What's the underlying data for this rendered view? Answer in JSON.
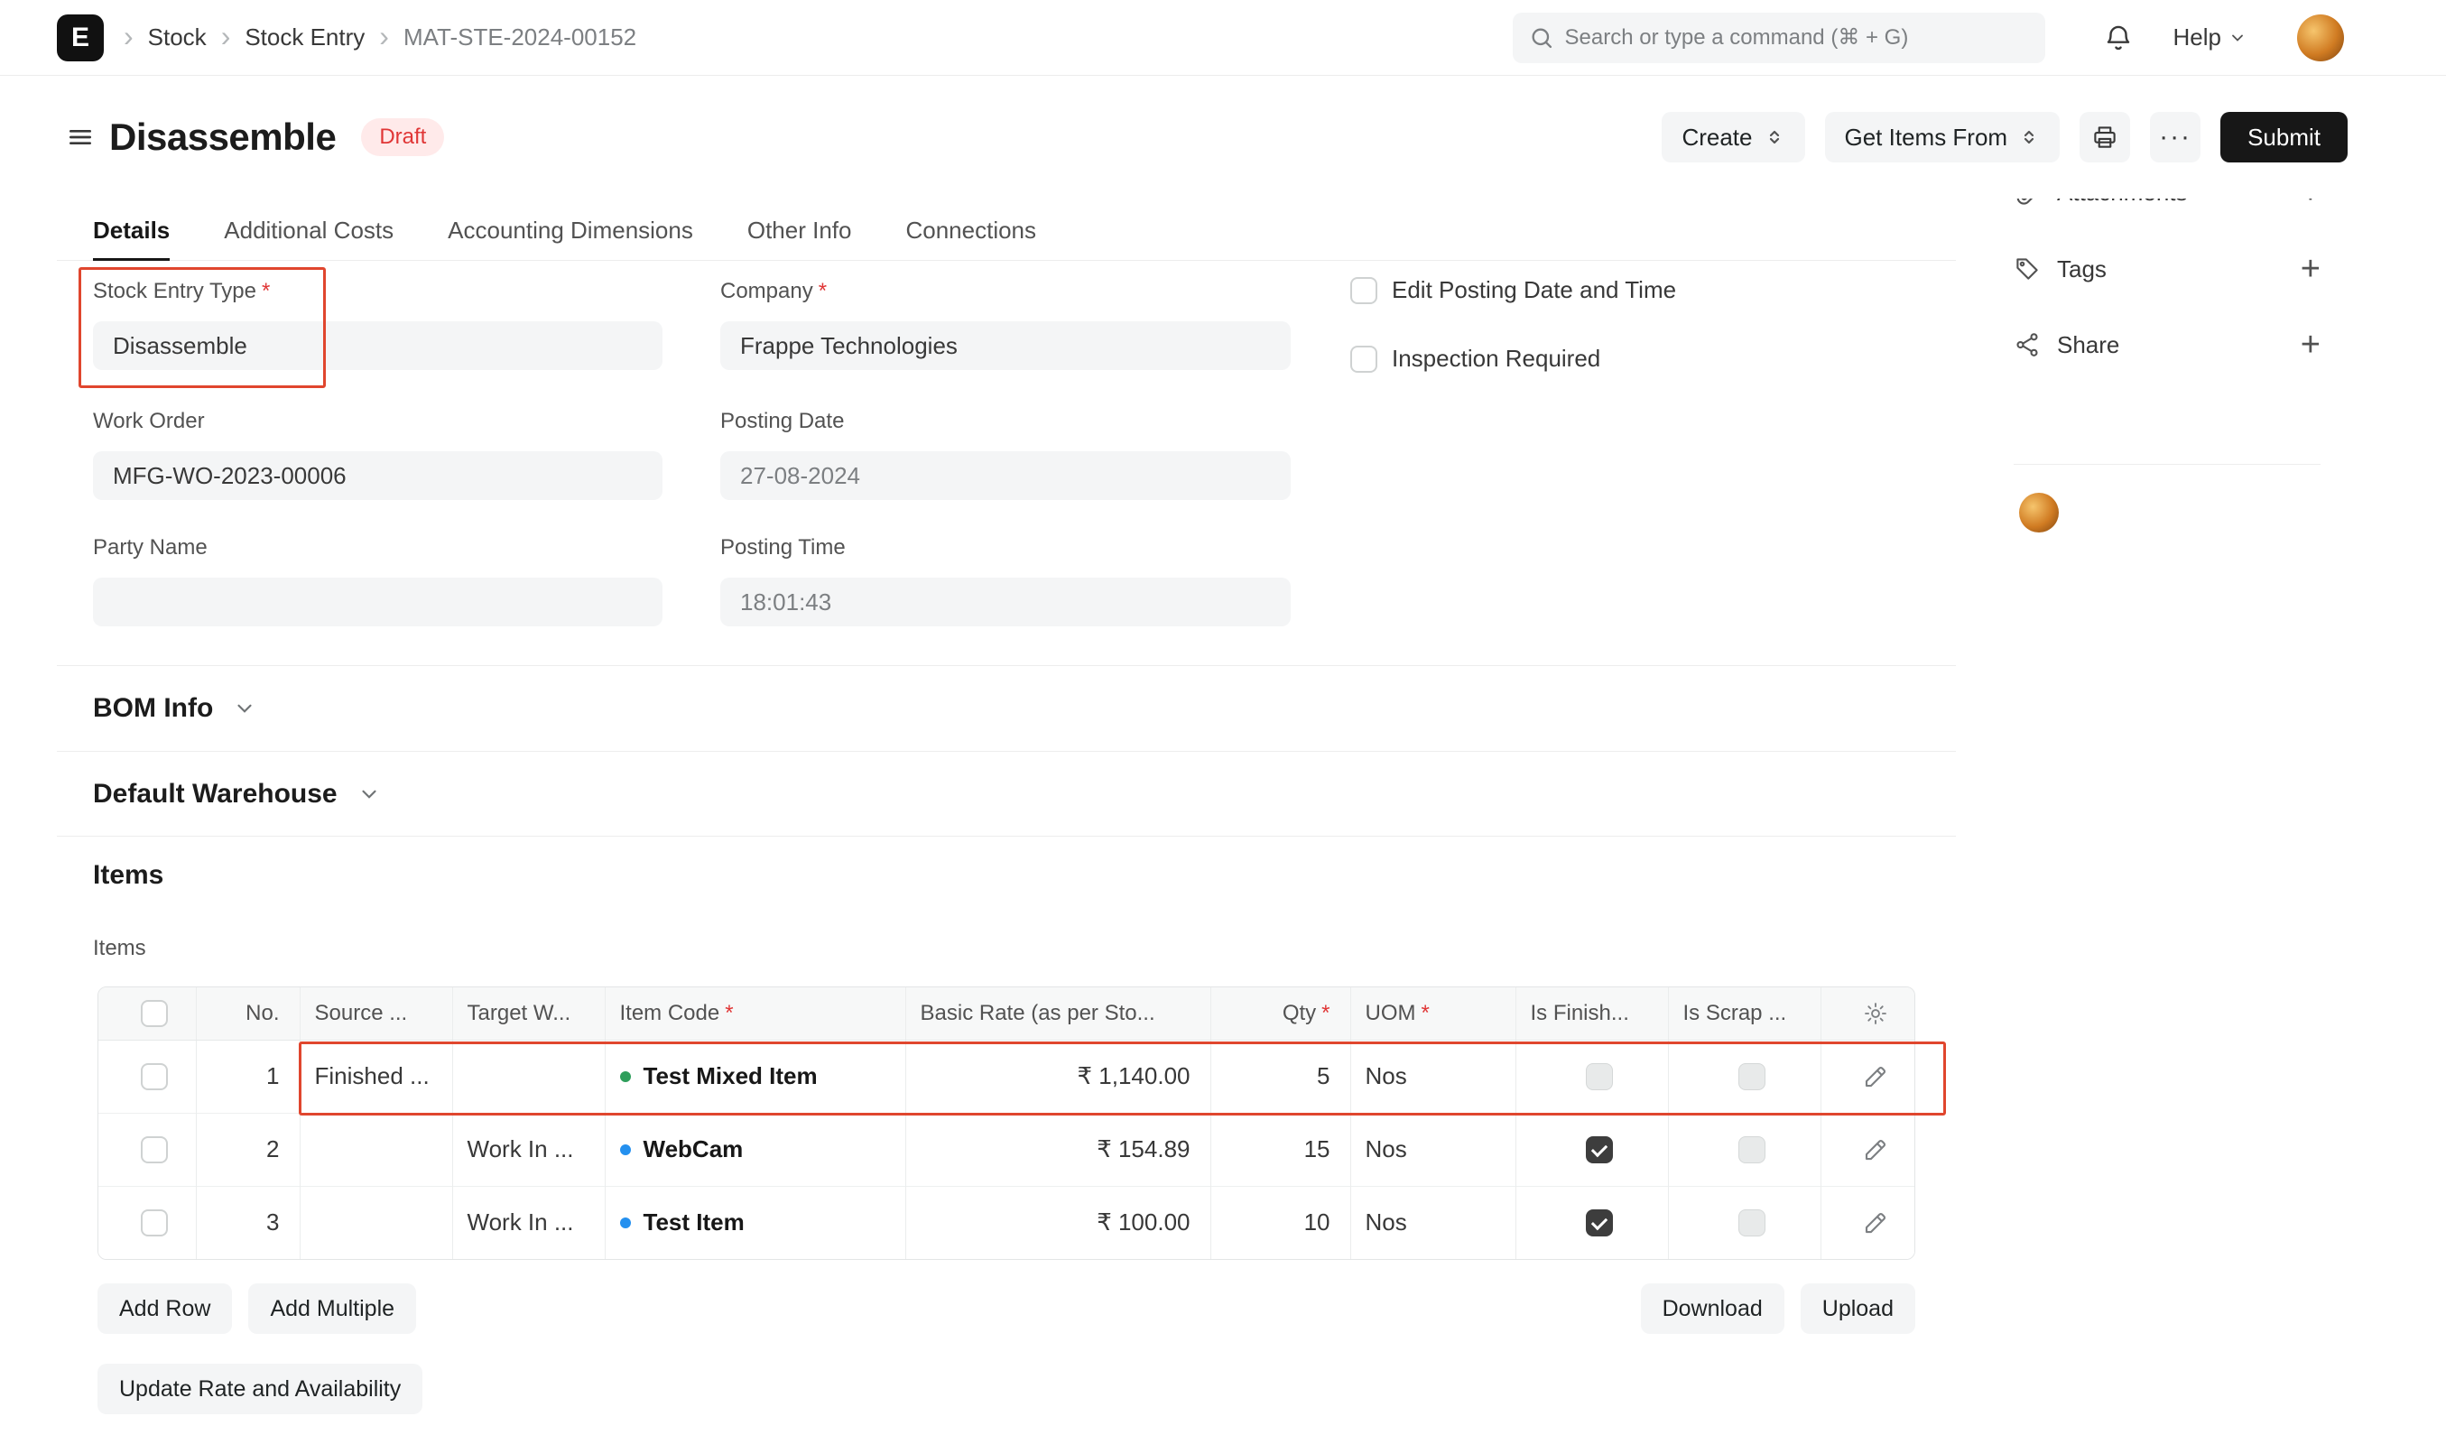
{
  "ui": {
    "required_marker": "*",
    "breadcrumb_sep": "›",
    "colors": {
      "accent_highlight_red": "#e0462e",
      "badge_red": "#e03636",
      "dot_green": "#2e9e5b",
      "dot_blue": "#2490ef",
      "submit_bg": "#171717",
      "input_bg": "#f4f5f6"
    }
  },
  "navbar": {
    "logo_letter": "E",
    "breadcrumbs": [
      "Stock",
      "Stock Entry",
      "MAT-STE-2024-00152"
    ],
    "search_placeholder": "Search or type a command (⌘ + G)",
    "help_label": "Help"
  },
  "header": {
    "title": "Disassemble",
    "status_badge": "Draft",
    "create_label": "Create",
    "get_items_label": "Get Items From",
    "more_label": "···",
    "submit_label": "Submit"
  },
  "tabs": [
    "Details",
    "Additional Costs",
    "Accounting Dimensions",
    "Other Info",
    "Connections"
  ],
  "form": {
    "stock_entry_type": {
      "label": "Stock Entry Type",
      "value": "Disassemble"
    },
    "company": {
      "label": "Company",
      "value": "Frappe Technologies"
    },
    "edit_posting": {
      "label": "Edit Posting Date and Time",
      "state": "unchecked"
    },
    "inspection": {
      "label": "Inspection Required",
      "state": "unchecked"
    },
    "work_order": {
      "label": "Work Order",
      "value": "MFG-WO-2023-00006"
    },
    "posting_date": {
      "label": "Posting Date",
      "value": "27-08-2024"
    },
    "party_name": {
      "label": "Party Name",
      "value": ""
    },
    "posting_time": {
      "label": "Posting Time",
      "value": "18:01:43"
    }
  },
  "sections": {
    "bom_info": "BOM Info",
    "default_warehouse": "Default Warehouse"
  },
  "items": {
    "section_title": "Items",
    "field_label": "Items",
    "columns": {
      "no": "No.",
      "source": "Source ...",
      "target": "Target W...",
      "item_code": "Item Code",
      "basic_rate": "Basic Rate (as per Sto...",
      "qty": "Qty",
      "uom": "UOM",
      "is_finished": "Is Finish...",
      "is_scrap": "Is Scrap ..."
    },
    "rows": [
      {
        "no": "1",
        "source": "Finished ...",
        "target": "",
        "item": "Test Mixed Item",
        "dot": "green",
        "rate": "₹ 1,140.00",
        "qty": "5",
        "uom": "Nos",
        "finished": "unchecked",
        "scrap": "unchecked"
      },
      {
        "no": "2",
        "source": "",
        "target": "Work In ...",
        "item": "WebCam",
        "dot": "blue",
        "rate": "₹ 154.89",
        "qty": "15",
        "uom": "Nos",
        "finished": "checked",
        "scrap": "unchecked"
      },
      {
        "no": "3",
        "source": "",
        "target": "Work In ...",
        "item": "Test Item",
        "dot": "blue",
        "rate": "₹ 100.00",
        "qty": "10",
        "uom": "Nos",
        "finished": "checked",
        "scrap": "unchecked"
      }
    ],
    "add_row_label": "Add Row",
    "add_multiple_label": "Add Multiple",
    "download_label": "Download",
    "upload_label": "Upload",
    "update_rate_label": "Update Rate and Availability"
  },
  "sidebar": {
    "attachments_label": "Attachments",
    "tags_label": "Tags",
    "share_label": "Share",
    "plus": "+"
  }
}
